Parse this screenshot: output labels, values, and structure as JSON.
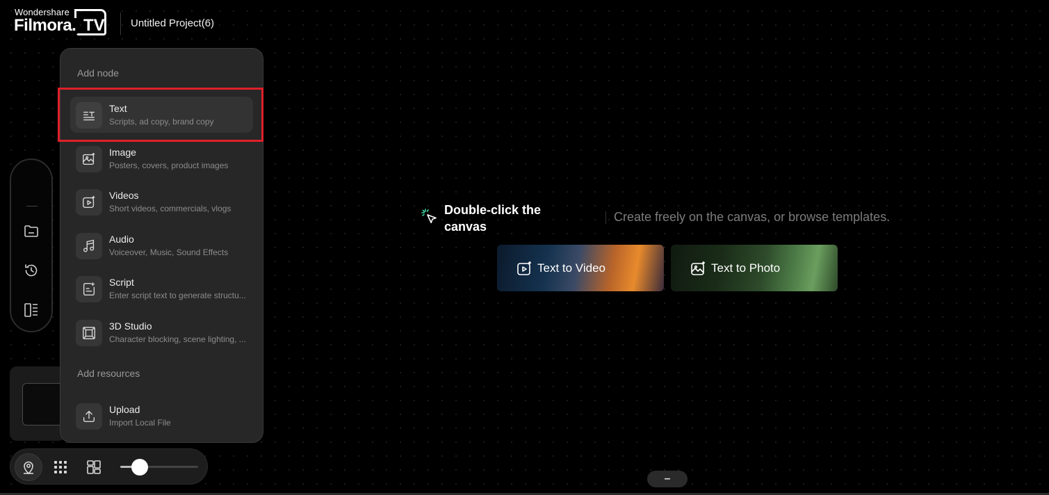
{
  "header": {
    "brand_top": "Wondershare",
    "brand_main": "Filmora.",
    "brand_tv": "TV",
    "project_title": "Untitled Project(6)"
  },
  "left_toolbar": {
    "icons": [
      "folder-icon",
      "history-icon",
      "layout-icon"
    ]
  },
  "menu": {
    "section_add_node": "Add node",
    "items": [
      {
        "title": "Text",
        "subtitle": "Scripts, ad copy, brand copy",
        "icon": "text-icon"
      },
      {
        "title": "Image",
        "subtitle": "Posters, covers, product images",
        "icon": "image-icon"
      },
      {
        "title": "Videos",
        "subtitle": "Short videos, commercials, vlogs",
        "icon": "video-icon"
      },
      {
        "title": "Audio",
        "subtitle": "Voiceover, Music, Sound Effects",
        "icon": "music-icon"
      },
      {
        "title": "Script",
        "subtitle": "Enter script text to generate structu...",
        "icon": "script-icon"
      },
      {
        "title": "3D Studio",
        "subtitle": "Character blocking, scene lighting, ...",
        "icon": "cube-icon"
      }
    ],
    "section_add_resources": "Add resources",
    "resources": [
      {
        "title": "Upload",
        "subtitle": "Import Local File",
        "icon": "upload-icon"
      }
    ],
    "highlighted_item": "Text"
  },
  "canvas_hint": {
    "title": "Double-click the canvas",
    "subtitle": "Create freely on the canvas, or browse templates."
  },
  "templates": [
    {
      "label": "Text to Video",
      "icon": "video-spark-icon"
    },
    {
      "label": "Text to Photo",
      "icon": "image-spark-icon"
    }
  ],
  "bottom_controls": {
    "icons": [
      "location-pin-icon",
      "grid-icon",
      "layout-grid-icon"
    ],
    "zoom_fraction": 0.25
  },
  "bottom_pill": {
    "label": "–"
  },
  "colors": {
    "background": "#000000",
    "menu_bg": "#272727",
    "highlight": "#e0202a"
  }
}
